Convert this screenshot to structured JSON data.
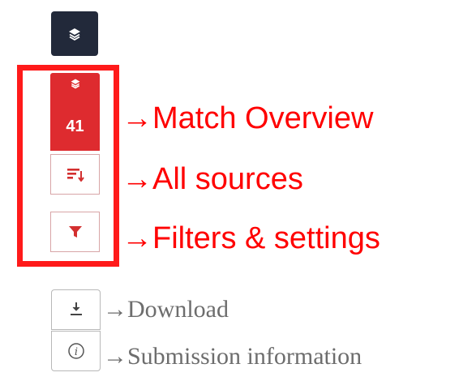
{
  "sidebar": {
    "match_count": "41"
  },
  "annotations": {
    "match_overview": "Match Overview",
    "all_sources": "All sources",
    "filters_settings": "Filters & settings",
    "download": "Download",
    "submission_info": "Submission information"
  },
  "colors": {
    "highlight": "#ff1a1a",
    "match_red": "#de2b2f",
    "dark": "#22293a",
    "label_red": "#ff0000",
    "label_grey": "#6d6d6d"
  },
  "icons": [
    "layers-icon",
    "sort-descending-icon",
    "filter-icon",
    "download-icon",
    "info-icon"
  ]
}
